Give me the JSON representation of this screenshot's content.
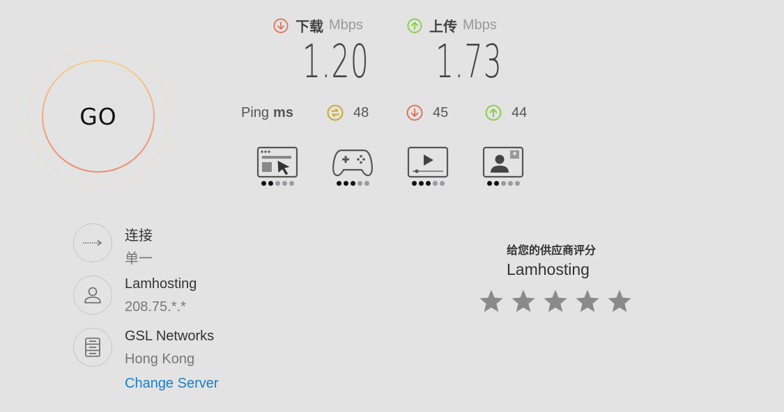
{
  "go": {
    "label": "GO"
  },
  "download": {
    "label": "下载",
    "unit": "Mbps",
    "value": "1.20",
    "color": "#e06a50"
  },
  "upload": {
    "label": "上传",
    "unit": "Mbps",
    "value": "1.73",
    "color": "#7ccd35"
  },
  "ping": {
    "label": "Ping",
    "unit": "ms",
    "idle": "48",
    "download": "45",
    "upload": "44",
    "idle_color": "#c9a21a"
  },
  "activities": [
    {
      "icon": "browsing-icon",
      "rating": 2
    },
    {
      "icon": "gaming-icon",
      "rating": 3
    },
    {
      "icon": "streaming-icon",
      "rating": 3
    },
    {
      "icon": "video-chat-icon",
      "rating": 2
    }
  ],
  "connection": {
    "title": "连接",
    "value": "单一"
  },
  "isp": {
    "name": "Lamhosting",
    "ip": "208.75.*.*"
  },
  "server": {
    "name": "GSL Networks",
    "location": "Hong Kong",
    "change_label": "Change Server",
    "link_color": "#1a7fc9"
  },
  "rating": {
    "title": "给您的供应商评分",
    "provider": "Lamhosting",
    "stars": 5
  }
}
